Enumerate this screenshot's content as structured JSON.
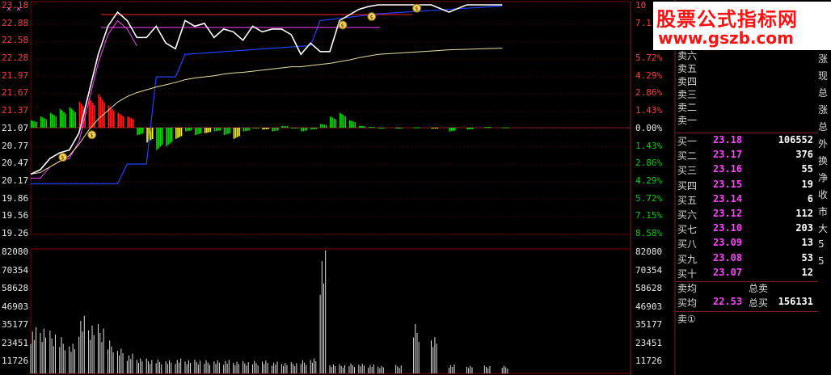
{
  "price_axis_left": [
    "23.18",
    "22.88",
    "22.58",
    "22.28",
    "21.97",
    "21.67",
    "21.37",
    "21.07",
    "20.77",
    "20.47",
    "20.17",
    "19.86",
    "19.56",
    "19.26"
  ],
  "pct_axis_right": [
    "10",
    "7.1",
    "5.72%",
    "4.29%",
    "2.86%",
    "1.43%",
    "0.00%",
    "1.43%",
    "2.86%",
    "4.29%",
    "5.72%",
    "7.15%",
    "8.58%"
  ],
  "flag_value": "22",
  "vol_axis": [
    "82080",
    "70354",
    "58628",
    "46903",
    "35177",
    "23451",
    "11726"
  ],
  "sell_labels": [
    "卖六",
    "卖五",
    "卖四",
    "卖三",
    "卖二",
    "卖一"
  ],
  "buy_rows": [
    {
      "label": "买一",
      "price": "23.18",
      "vol": "106552"
    },
    {
      "label": "买二",
      "price": "23.17",
      "vol": "376"
    },
    {
      "label": "买三",
      "price": "23.16",
      "vol": "55"
    },
    {
      "label": "买四",
      "price": "23.15",
      "vol": "19"
    },
    {
      "label": "买五",
      "price": "23.14",
      "vol": "6"
    },
    {
      "label": "买六",
      "price": "23.12",
      "vol": "112"
    },
    {
      "label": "买七",
      "price": "23.10",
      "vol": "203"
    },
    {
      "label": "买八",
      "price": "23.09",
      "vol": "13"
    },
    {
      "label": "买九",
      "price": "23.08",
      "vol": "53"
    },
    {
      "label": "买十",
      "price": "23.07",
      "vol": "12"
    }
  ],
  "avg_sell_label": "卖均",
  "total_sell_label": "总卖",
  "avg_buy_label": "买均",
  "avg_buy_price": "22.53",
  "total_buy_label": "总买",
  "total_buy_value": "156131",
  "sell_circle_label": "卖①",
  "right_col_chars": [
    "涨",
    "现",
    "总",
    "涨",
    "总",
    "外",
    "换",
    "净",
    "收",
    "市",
    "大",
    "5",
    "5"
  ],
  "watermark_line1": "股票公式指标网",
  "watermark_line2": "www.gszb.com",
  "top_marks": "×   ×",
  "colors": {
    "price": "#ffffff",
    "avg": "#e8e0a0",
    "blue": "#2040ff",
    "magenta": "#ff40ff",
    "red": "#ff2020",
    "green": "#00e000",
    "yellow": "#ffff00",
    "grid": "#404040"
  },
  "chart_data": {
    "type": "line",
    "price_line": [
      20.17,
      20.25,
      20.45,
      20.55,
      20.6,
      20.9,
      21.6,
      22.3,
      22.8,
      23.05,
      22.9,
      22.6,
      22.6,
      22.8,
      22.5,
      22.4,
      22.9,
      22.8,
      22.85,
      22.6,
      22.75,
      22.7,
      22.55,
      22.8,
      22.7,
      22.75,
      22.75,
      22.65,
      22.3,
      22.5,
      22.35,
      22.35,
      22.9,
      23.0,
      23.1,
      23.15,
      23.18,
      23.18,
      23.18,
      23.18,
      23.05,
      23.18,
      23.18,
      23.18
    ],
    "avg_line": [
      20.17,
      20.2,
      20.3,
      20.4,
      20.5,
      20.7,
      20.95,
      21.15,
      21.3,
      21.45,
      21.55,
      21.62,
      21.67,
      21.72,
      21.76,
      21.8,
      21.85,
      21.88,
      21.9,
      21.92,
      21.95,
      21.97,
      21.98,
      22.0,
      22.02,
      22.04,
      22.06,
      22.08,
      22.08,
      22.1,
      22.12,
      22.14,
      22.17,
      22.2,
      22.24,
      22.27,
      22.3,
      22.32,
      22.34,
      22.36,
      22.38,
      22.39,
      22.4,
      22.41
    ],
    "macd_bars": [
      0.2,
      0.3,
      0.4,
      0.5,
      0.55,
      0.7,
      0.8,
      0.9,
      0.6,
      0.4,
      0.3,
      -0.2,
      -0.4,
      -0.6,
      -0.5,
      -0.3,
      -0.1,
      -0.2,
      -0.15,
      -0.1,
      -0.2,
      -0.3,
      -0.1,
      0.0,
      -0.05,
      -0.1,
      0.05,
      0.0,
      -0.1,
      -0.05,
      0.1,
      0.3,
      0.4,
      0.2,
      0.05,
      0.02,
      0.0,
      0.0,
      0.01,
      -0.02,
      -0.1,
      -0.05,
      0.02,
      0.01
    ],
    "volumes": [
      28000,
      30000,
      26000,
      22000,
      18000,
      35000,
      32000,
      30000,
      20000,
      15000,
      12000,
      10000,
      9000,
      8500,
      8000,
      9000,
      8800,
      8400,
      8000,
      7900,
      8200,
      7800,
      7500,
      7600,
      7800,
      7200,
      7000,
      6800,
      8000,
      9000,
      75000,
      6000,
      5500,
      6000,
      5800,
      5500,
      5000,
      5200,
      30000,
      22000,
      5400,
      5000,
      4800,
      4600
    ]
  }
}
